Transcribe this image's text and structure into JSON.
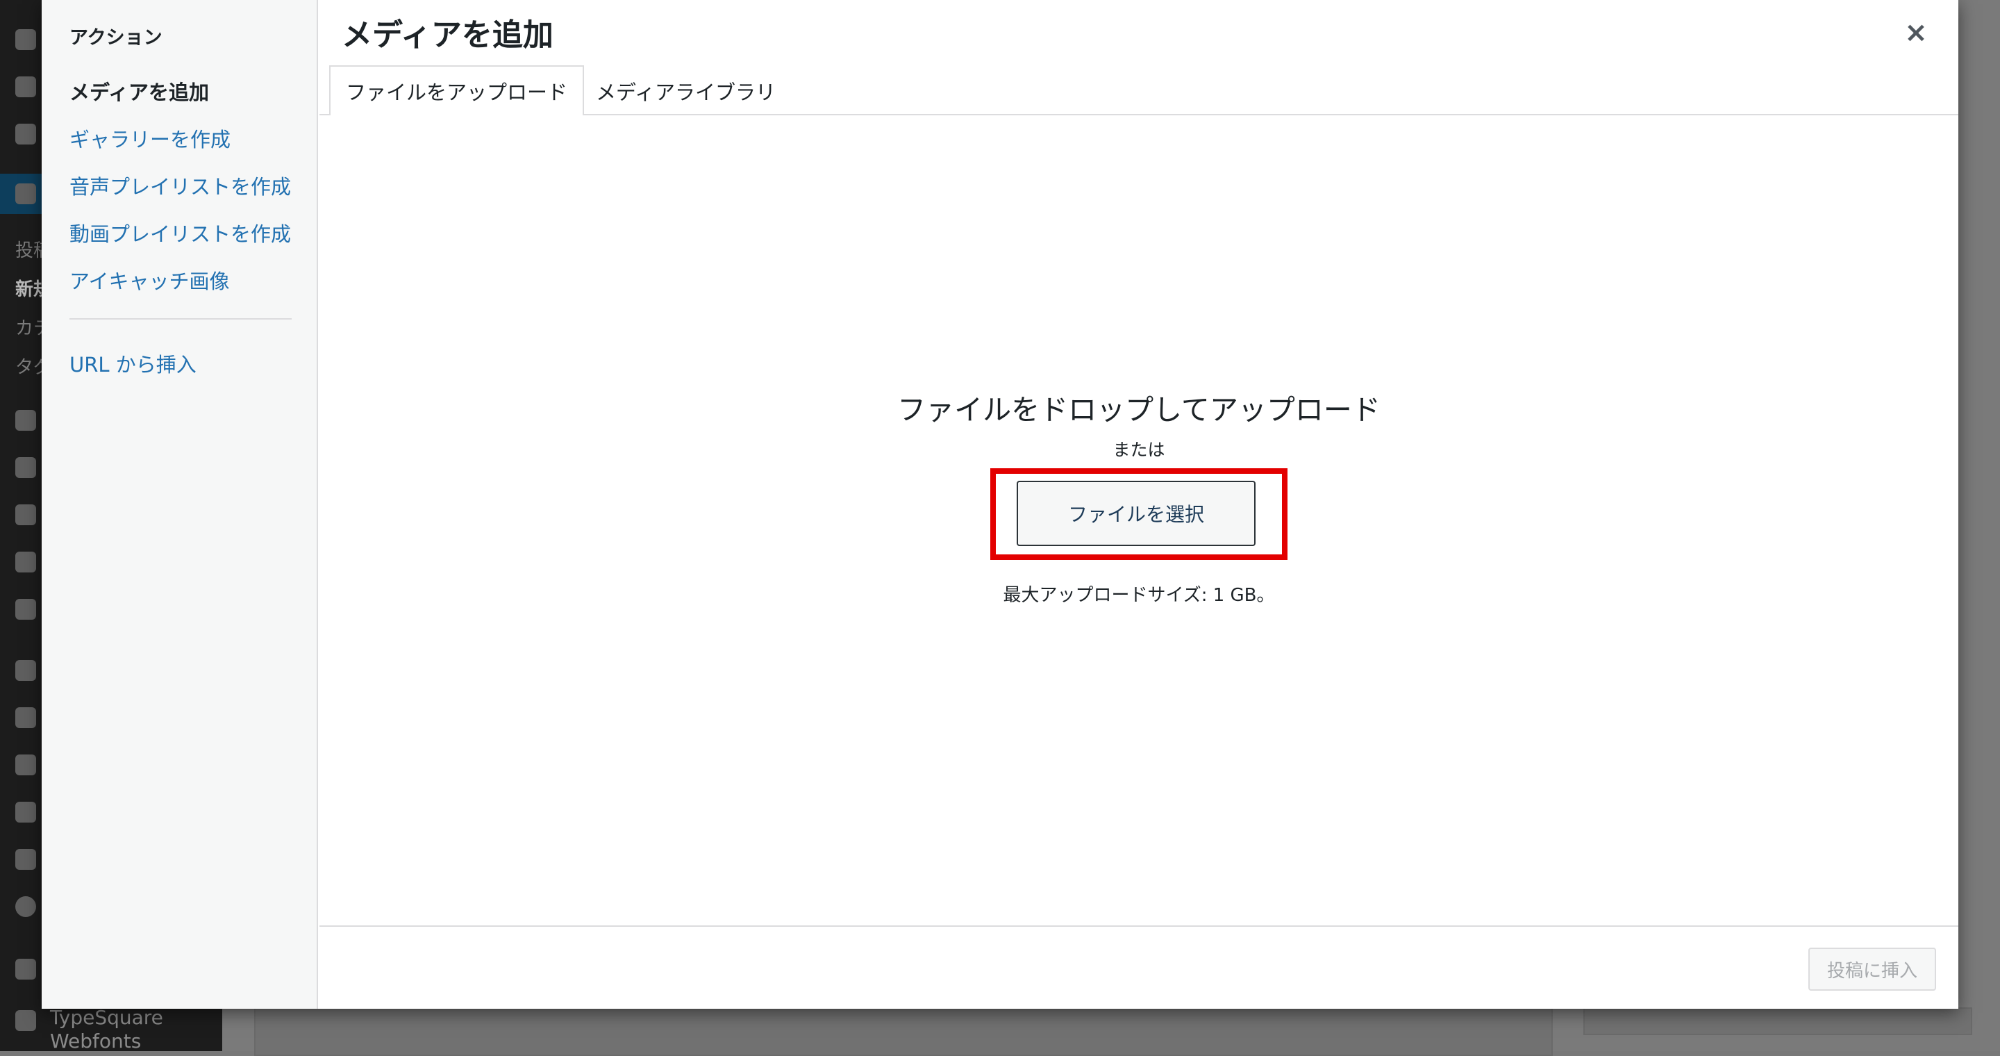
{
  "background": {
    "sidebar_sub_items": [
      "投稿",
      "新規",
      "カテ",
      "タグ"
    ],
    "sidebar_footer": {
      "label_line1": "TypeSquare",
      "label_line2": "Webfonts"
    }
  },
  "modal": {
    "menu": {
      "heading": "アクション",
      "items": [
        {
          "label": "メディアを追加",
          "active": true
        },
        {
          "label": "ギャラリーを作成",
          "active": false
        },
        {
          "label": "音声プレイリストを作成",
          "active": false
        },
        {
          "label": "動画プレイリストを作成",
          "active": false
        },
        {
          "label": "アイキャッチ画像",
          "active": false
        }
      ],
      "url_insert": "URL から挿入"
    },
    "title": "メディアを追加",
    "close_symbol": "×",
    "tabs": [
      {
        "label": "ファイルをアップロード",
        "active": true
      },
      {
        "label": "メディアライブラリ",
        "active": false
      }
    ],
    "uploader": {
      "drop_title": "ファイルをドロップしてアップロード",
      "or_text": "または",
      "select_button": "ファイルを選択",
      "max_size": "最大アップロードサイズ: 1 GB。"
    },
    "toolbar": {
      "insert_button": "投稿に挿入"
    }
  },
  "colors": {
    "highlight": "#e30000",
    "link": "#2271b1",
    "text": "#1d2327"
  }
}
